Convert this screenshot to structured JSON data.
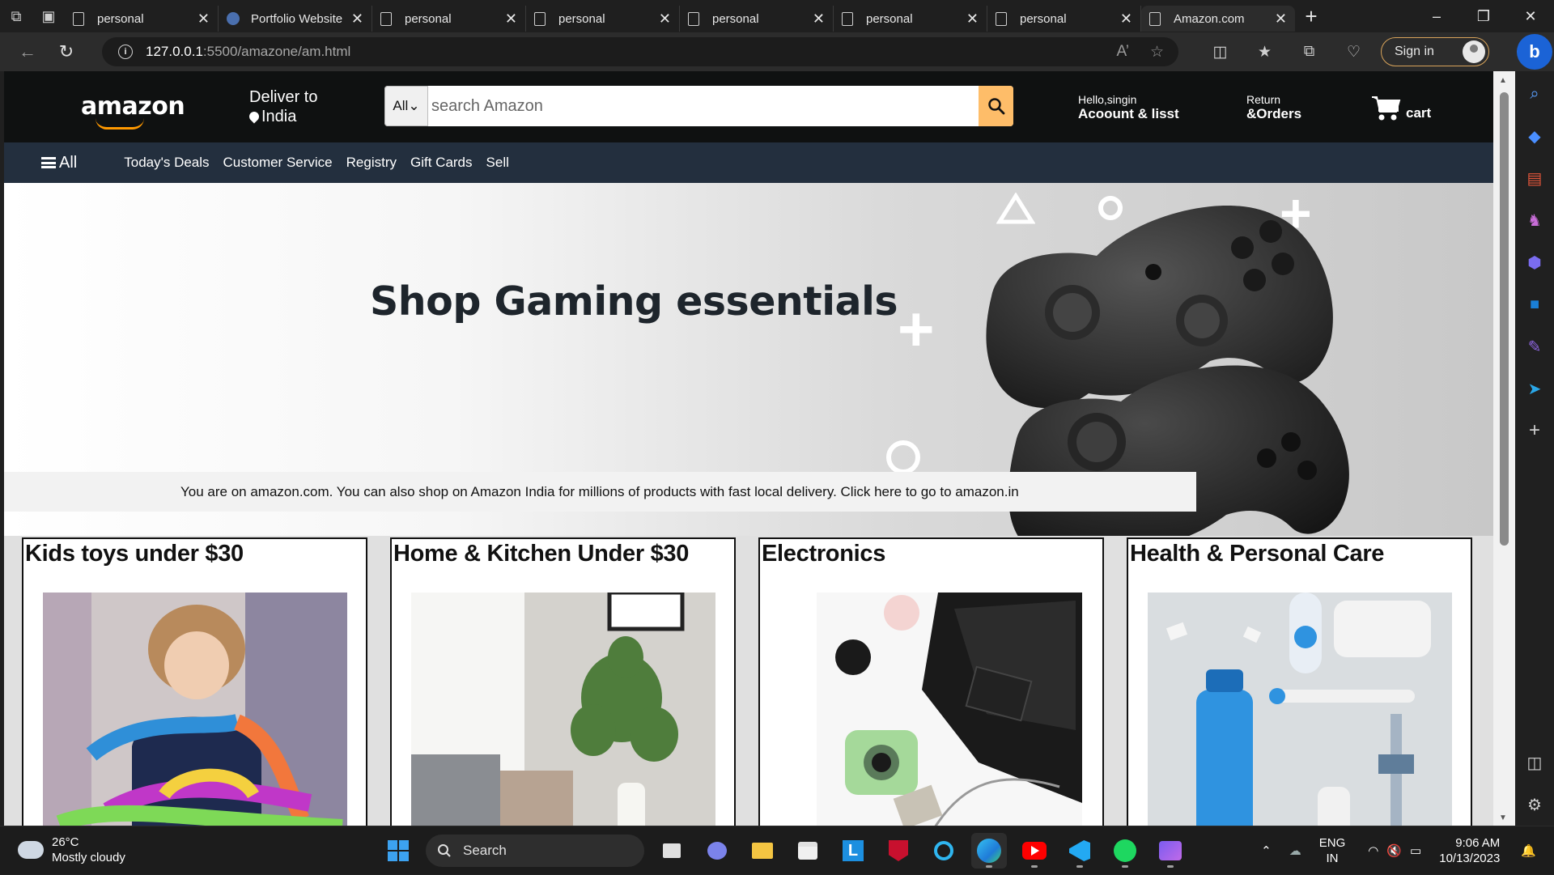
{
  "browser": {
    "tabs": [
      {
        "label": "personal",
        "icon": "doc"
      },
      {
        "label": "Portfolio Website",
        "icon": "github"
      },
      {
        "label": "personal",
        "icon": "doc"
      },
      {
        "label": "personal",
        "icon": "doc"
      },
      {
        "label": "personal",
        "icon": "doc"
      },
      {
        "label": "personal",
        "icon": "doc"
      },
      {
        "label": "personal",
        "icon": "doc"
      },
      {
        "label": "Amazon.com",
        "icon": "doc",
        "active": true
      }
    ],
    "url_host": "127.0.0.1",
    "url_path": ":5500/amazone/am.html",
    "signin_label": "Sign in",
    "bing_label": "b"
  },
  "amazon": {
    "logo_text": "amazon",
    "deliver_line1": "Deliver to",
    "deliver_line2": "India",
    "search_category": "All",
    "search_placeholder": "search Amazon",
    "account_small": "Hello,singin",
    "account_big": "Acoount & lisst",
    "orders_small": "Return",
    "orders_big": "&Orders",
    "cart_label": "cart",
    "nav": {
      "all_label": "All",
      "links": [
        "Today's Deals",
        "Customer Service",
        "Registry",
        "Gift Cards",
        "Sell"
      ]
    },
    "hero_title": "Shop Gaming essentials",
    "notice": "You are on amazon.com. You can also shop on Amazon India for millions of products with fast local delivery. Click here to go to amazon.in",
    "cards": [
      {
        "title": "Kids toys under $30"
      },
      {
        "title": "Home & Kitchen Under $30"
      },
      {
        "title": "Electronics"
      },
      {
        "title": "Health & Personal Care"
      }
    ]
  },
  "taskbar": {
    "temperature": "26°C",
    "weather": "Mostly cloudy",
    "search_label": "Search",
    "lang_line1": "ENG",
    "lang_line2": "IN",
    "time": "9:06 AM",
    "date": "10/13/2023"
  },
  "colors": {
    "amazon_header": "#0f1111",
    "amazon_nav": "#232f3e",
    "search_button": "#febd69",
    "logo_smile": "#ff9900"
  }
}
